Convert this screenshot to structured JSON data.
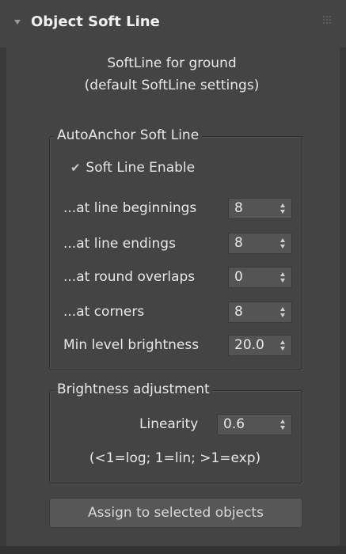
{
  "rollout": {
    "title": "Object Soft Line",
    "expand_icon": "triangle-down-icon",
    "grip_icon": "drag-grip-icon"
  },
  "header_text": {
    "line1": "SoftLine for ground",
    "line2": "(default SoftLine settings)"
  },
  "auto_anchor": {
    "group_label": "AutoAnchor Soft Line",
    "enable_label": "Soft Line Enable",
    "enable_checked": true,
    "rows": [
      {
        "label": "...at line beginnings",
        "value": "8"
      },
      {
        "label": "...at line endings",
        "value": "8"
      },
      {
        "label": "...at round overlaps",
        "value": "0"
      },
      {
        "label": "...at corners",
        "value": "8"
      },
      {
        "label": "Min level brightness",
        "value": "20.0"
      }
    ]
  },
  "brightness": {
    "group_label": "Brightness adjustment",
    "linearity_label": "Linearity",
    "linearity_value": "0.6",
    "hint": "(<1=log; 1=lin; >1=exp)"
  },
  "actions": {
    "assign_label": "Assign to selected objects"
  },
  "colors": {
    "panel_bg": "#444444",
    "field_bg": "#545454",
    "button_bg": "#575757",
    "text": "#e8e8e8"
  }
}
